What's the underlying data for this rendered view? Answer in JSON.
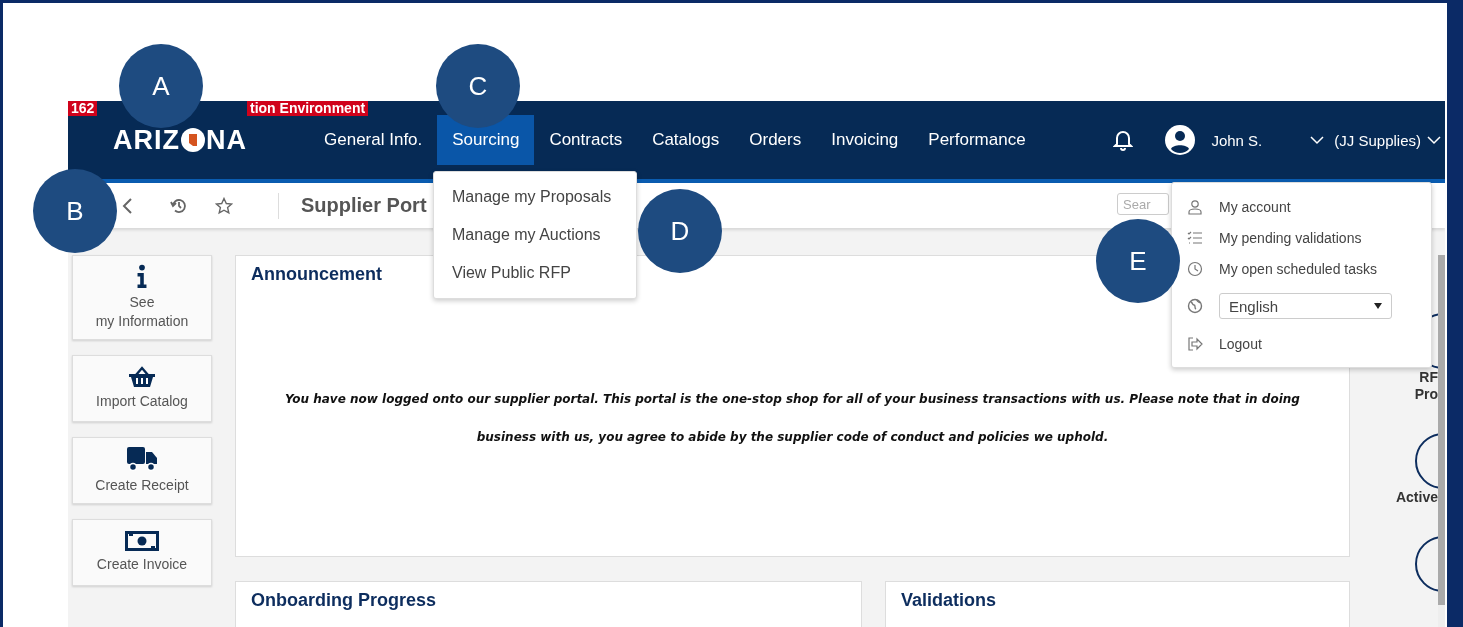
{
  "environment_badges": [
    "162",
    "tion Environment"
  ],
  "logo": {
    "text_before": "ARIZ",
    "text_after": "NA"
  },
  "nav": [
    {
      "label": "General Info.",
      "selected": false
    },
    {
      "label": "Sourcing",
      "selected": true
    },
    {
      "label": "Contracts",
      "selected": false
    },
    {
      "label": "Catalogs",
      "selected": false
    },
    {
      "label": "Orders",
      "selected": false
    },
    {
      "label": "Invoicing",
      "selected": false
    },
    {
      "label": "Performance",
      "selected": false
    }
  ],
  "user": {
    "name": "John S.",
    "company": "(JJ Supplies)"
  },
  "toolbar": {
    "title": "Supplier Port",
    "search": {
      "placeholder": "Sear"
    }
  },
  "sourcing_menu": [
    "Manage my Proposals",
    "Manage my Auctions",
    "View Public RFP"
  ],
  "user_menu": [
    {
      "kind": "item",
      "label": "My account"
    },
    {
      "kind": "item",
      "label": "My pending validations"
    },
    {
      "kind": "item",
      "label": "My open scheduled tasks"
    },
    {
      "kind": "select",
      "label": "English"
    },
    {
      "kind": "item",
      "label": "Logout"
    }
  ],
  "quick_actions": [
    {
      "label": "See\nmy Information"
    },
    {
      "label": "Import Catalog"
    },
    {
      "label": "Create Receipt"
    },
    {
      "label": "Create Invoice"
    }
  ],
  "announcement": {
    "title": "Announcement",
    "text": "You have now logged onto our supplier portal. This portal is the one-stop shop for all of your business transactions with us. Please note that in doing business with us, you agree to abide by the supplier code of conduct and policies we uphold."
  },
  "onboarding": {
    "title": "Onboarding Progress"
  },
  "validations": {
    "title": "Validations"
  },
  "right_widgets": [
    {
      "label": "RF\nPro"
    },
    {
      "label": "Active"
    }
  ],
  "annotations": [
    "A",
    "B",
    "C",
    "D",
    "E"
  ]
}
